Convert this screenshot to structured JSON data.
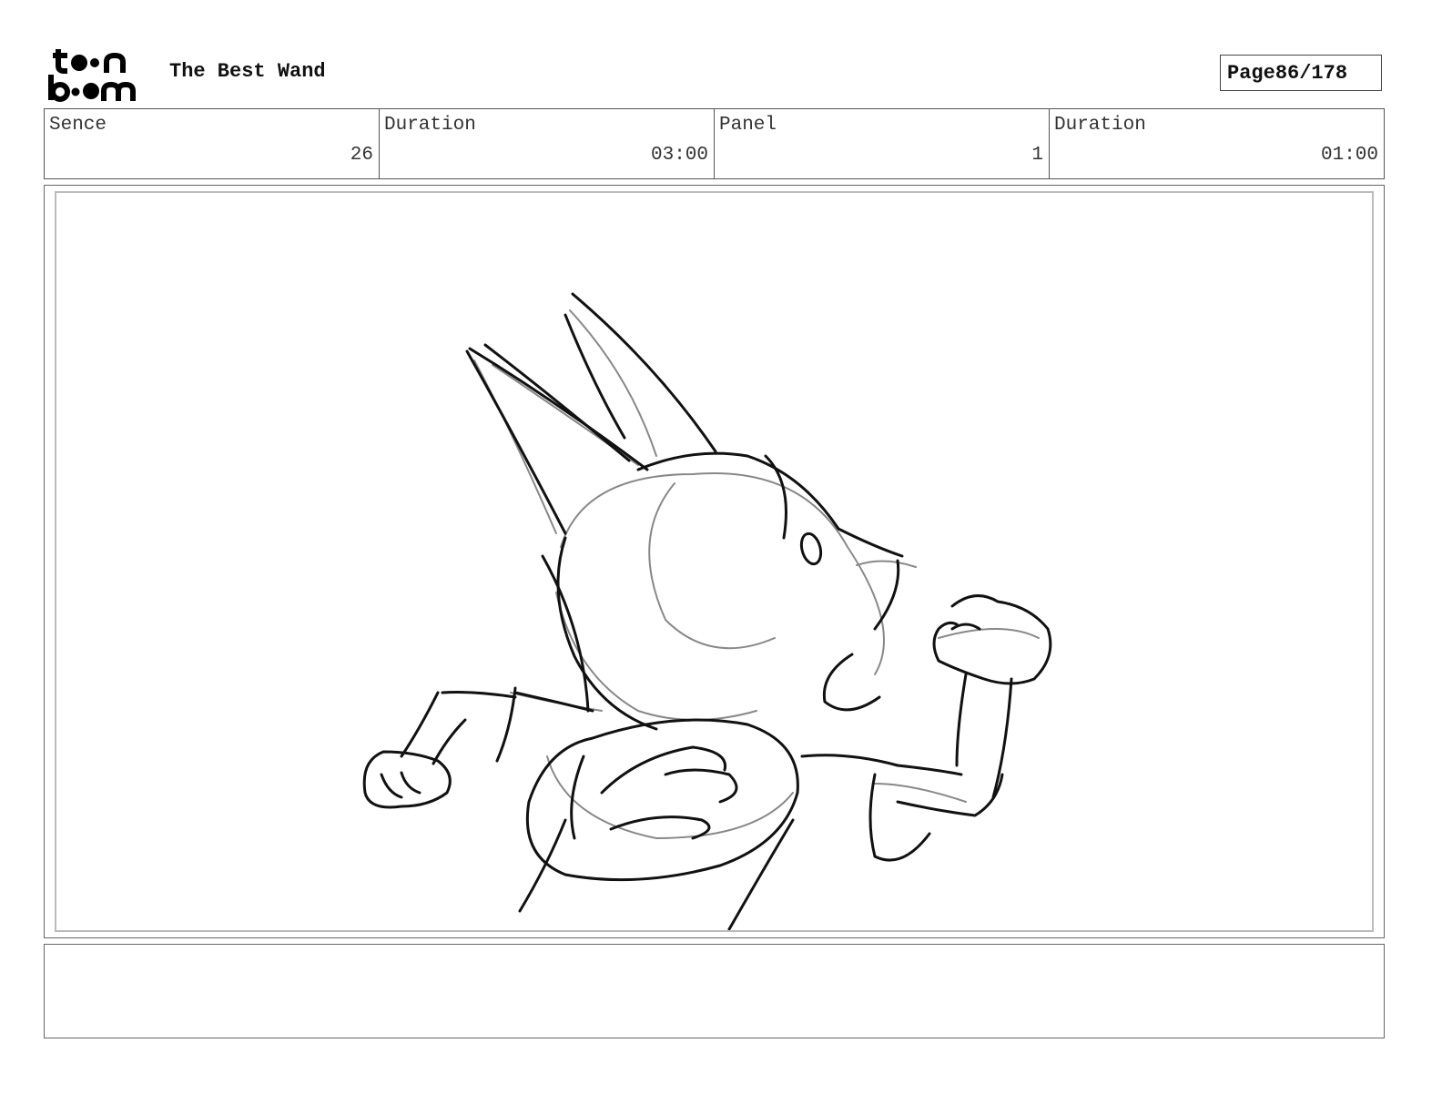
{
  "header": {
    "logo_text_line1": "toon",
    "logo_text_line2": "boom",
    "title": "The Best Wand",
    "page_label": "Page",
    "page_value": "86/178"
  },
  "info": {
    "scene_label": "Sence",
    "scene_value": "26",
    "scene_duration_label": "Duration",
    "scene_duration_value": "03:00",
    "panel_label": "Panel",
    "panel_value": "1",
    "panel_duration_label": "Duration",
    "panel_duration_value": "01:00"
  },
  "panel": {
    "image_subject": "rough pencil sketch of a cat-eared character with a backpack, fist raised"
  },
  "notes": {
    "text": ""
  }
}
